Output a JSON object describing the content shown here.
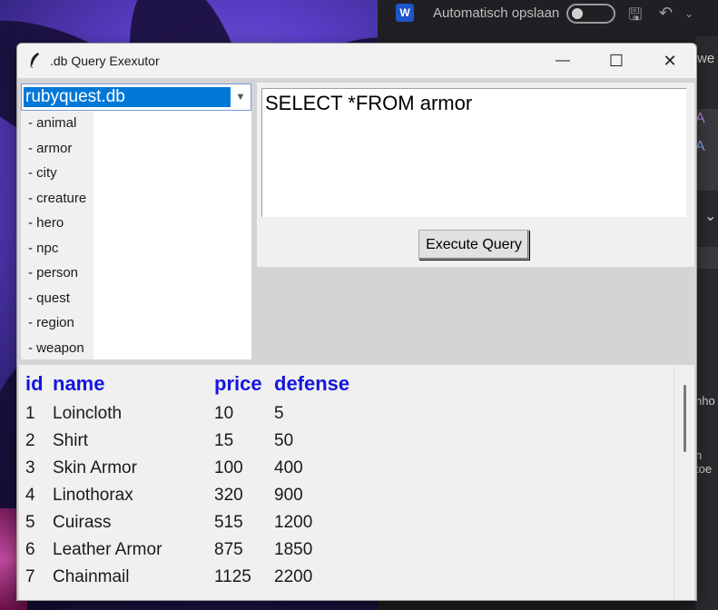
{
  "word": {
    "autosave_label": "Automatisch opslaan",
    "logo": "W",
    "side_texts": [
      "we",
      "nho",
      "n toe"
    ]
  },
  "window": {
    "title": ".db Query Exexutor",
    "minimize": "—",
    "maximize": "☐",
    "close": "✕"
  },
  "database": {
    "selected": "rubyquest.db",
    "tables": [
      "- animal",
      "- armor",
      "- city",
      "- creature",
      "- hero",
      "- npc",
      "- person",
      "- quest",
      "- region",
      "- weapon"
    ]
  },
  "query": {
    "text": "SELECT *FROM armor",
    "execute_label": "Execute Query"
  },
  "results": {
    "columns": [
      "id",
      "name",
      "price",
      "defense"
    ],
    "rows": [
      [
        "1",
        "Loincloth",
        "10",
        "5"
      ],
      [
        "2",
        "Shirt",
        "15",
        "50"
      ],
      [
        "3",
        "Skin Armor",
        "100",
        "400"
      ],
      [
        "4",
        "Linothorax",
        "320",
        "900"
      ],
      [
        "5",
        "Cuirass",
        "515",
        "1200"
      ],
      [
        "6",
        "Leather Armor",
        "875",
        "1850"
      ],
      [
        "7",
        "Chainmail",
        "1125",
        "2200"
      ]
    ]
  },
  "colors": {
    "header_text": "#1515e0",
    "selection": "#0078d7"
  }
}
